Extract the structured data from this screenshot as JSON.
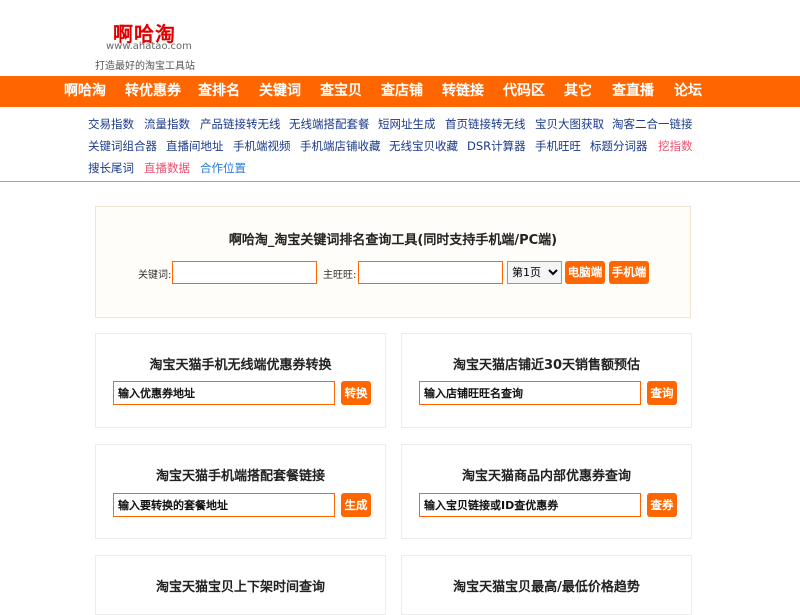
{
  "header": {
    "logo": "啊哈淘",
    "url": "www.ahatao.com",
    "slogan": "打造最好的淘宝工具站"
  },
  "nav": [
    "啊哈淘",
    "转优惠券",
    "查排名",
    "关键词",
    "查宝贝",
    "查店铺",
    "转链接",
    "代码区",
    "其它",
    "查直播",
    "论坛"
  ],
  "sublinks": {
    "row1": [
      "交易指数",
      "流量指数",
      "产品链接转无线",
      "无线端搭配套餐",
      "短网址生成",
      "首页链接转无线",
      "宝贝大图获取",
      "淘客二合一链接"
    ],
    "row2": [
      "关键词组合器",
      "直播间地址",
      "手机端视频",
      "手机端店铺收藏",
      "无线宝贝收藏",
      "DSR计算器",
      "手机旺旺",
      "标题分词器",
      "挖指数"
    ],
    "row3": [
      "搜长尾词",
      "直播数据",
      "合作位置"
    ]
  },
  "colors": {
    "accent": "#ff6600",
    "link": "#1a3a8a",
    "highlight": "#e8506e",
    "partner": "#2a7bd4"
  },
  "main_tool": {
    "title": "啊哈淘_淘宝关键词排名查询工具(同时支持手机端/PC端)",
    "keyword_label": "关键词:",
    "keyword_value": "",
    "wangwang_label": "主旺旺:",
    "wangwang_value": "",
    "page_select": "第1页",
    "pc_button": "电脑端",
    "mobile_button": "手机端"
  },
  "tools": [
    {
      "title": "淘宝天猫手机无线端优惠券转换",
      "placeholder": "输入优惠券地址",
      "button": "转换"
    },
    {
      "title": "淘宝天猫店铺近30天销售额预估",
      "placeholder": "输入店铺旺旺名查询",
      "button": "查询"
    },
    {
      "title": "淘宝天猫手机端搭配套餐链接",
      "placeholder": "输入要转换的套餐地址",
      "button": "生成"
    },
    {
      "title": "淘宝天猫商品内部优惠券查询",
      "placeholder": "输入宝贝链接或ID查优惠券",
      "button": "查券"
    },
    {
      "title": "淘宝天猫宝贝上下架时间查询"
    },
    {
      "title": "淘宝天猫宝贝最高/最低价格趋势"
    }
  ]
}
